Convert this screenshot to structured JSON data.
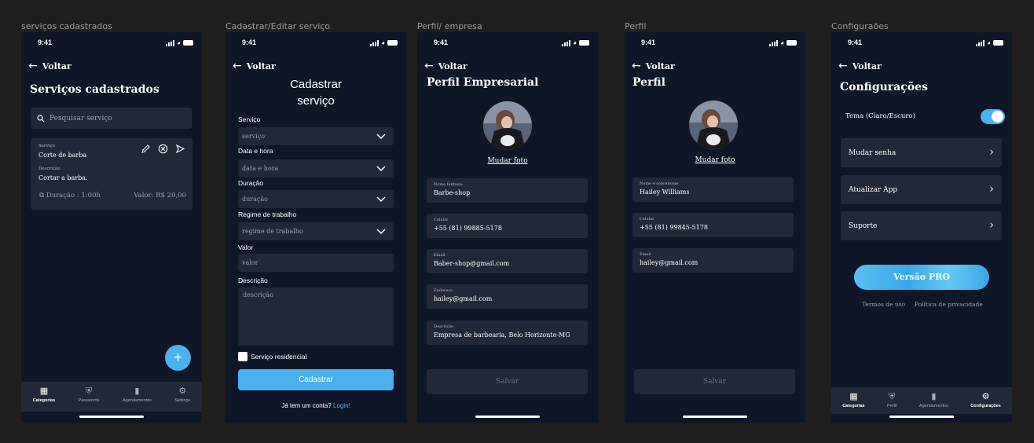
{
  "frames": [
    {
      "label": "serviços cadastrados"
    },
    {
      "label": "Cadastrar/Editar serviço"
    },
    {
      "label": "Perfil/ empresa"
    },
    {
      "label": "Perfil"
    },
    {
      "label": "Configuraões"
    }
  ],
  "status_time": "9:41",
  "back_label": "Voltar",
  "services": {
    "title": "Serviços cadastrados",
    "search_placeholder": "Pesquisar serviço",
    "card": {
      "service_label": "Serviço",
      "service_value": "Corte de barba",
      "description_label": "Descrição",
      "description_value": "Cortar a barba.",
      "duration": "Duração : 1:00h",
      "price": "Valor: R$ 20,00"
    },
    "fab_icon": "+",
    "tabs": [
      {
        "label": "Categorias",
        "icon": "grid-icon"
      },
      {
        "label": "Passwords",
        "icon": "shield-icon"
      },
      {
        "label": "Agendamentos",
        "icon": "bookmark-icon"
      },
      {
        "label": "Settings",
        "icon": "gear-icon"
      }
    ]
  },
  "form": {
    "title_line1": "Cadastrar",
    "title_line2": "serviço",
    "service_label": "Serviço",
    "service_placeholder": "serviço",
    "datetime_label": "Data e hora",
    "datetime_placeholder": "data e hora",
    "duration_label": "Duração",
    "duration_placeholder": "duração",
    "regime_label": "Regime de trabalho",
    "regime_placeholder": "regime de trabalho",
    "value_label": "Valor",
    "value_placeholder": "valor",
    "description_label": "Descrição",
    "description_placeholder": "descrição",
    "residential_label": "Serviço residencial",
    "submit_label": "Cadastrar",
    "login_question": "Já tem um conta?",
    "login_link": "Login!"
  },
  "company_profile": {
    "title": "Perfil Empresarial",
    "change_photo": "Mudar foto",
    "fields": [
      {
        "label": "Nome fantasia",
        "value": "Barbe-shop"
      },
      {
        "label": "Celular",
        "value": "+55 (81) 99885-5178"
      },
      {
        "label": "Email",
        "value": "Baber-shop@gmail.com"
      },
      {
        "label": "Endereço",
        "value": "hailey@gmail.com"
      },
      {
        "label": "Descrição",
        "value": "Empresa de barbearia, Belo Horizonte-MG"
      }
    ],
    "save_label": "Salvar"
  },
  "profile": {
    "title": "Perfil",
    "change_photo": "Mudar foto",
    "fields": [
      {
        "label": "Nome e sobrenome",
        "value": "Hailey Williams"
      },
      {
        "label": "Celular",
        "value": "+55 (81) 99845-5178"
      },
      {
        "label": "Email",
        "value": "hailey@gmail.com"
      }
    ],
    "save_label": "Salvar"
  },
  "settings": {
    "title": "Configurações",
    "theme_label": "Tema (Claro/Escuro)",
    "theme_on": true,
    "rows": [
      {
        "label": "Mudar senha"
      },
      {
        "label": "Atualizar App"
      },
      {
        "label": "Suporte"
      }
    ],
    "pro_label": "Versão PRO",
    "terms": "Termos de uso",
    "privacy": "Política de privacidade",
    "tabs": [
      {
        "label": "Categorias",
        "icon": "grid-icon"
      },
      {
        "label": "Perfil",
        "icon": "shield-icon"
      },
      {
        "label": "Agendamentos",
        "icon": "bookmark-icon"
      },
      {
        "label": "Configurações",
        "icon": "gear-icon"
      }
    ]
  },
  "colors": {
    "background": "#1e1e1e",
    "screen": "#0f1628",
    "surface": "#222839",
    "accent": "#49b1ee"
  }
}
